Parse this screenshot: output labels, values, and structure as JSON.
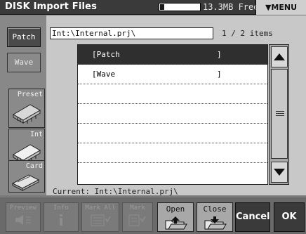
{
  "header": {
    "title": "DISK Import Files",
    "storage_free": "13.3MB Free",
    "storage_used_fraction": 0.1,
    "menu_label": "▼MENU"
  },
  "sidebar": {
    "type_buttons": [
      {
        "label": "Patch",
        "selected": true
      },
      {
        "label": "Wave",
        "selected": false
      }
    ],
    "devices": [
      {
        "label": "Preset",
        "icon": "chip-icon"
      },
      {
        "label": "Int",
        "icon": "chip-icon"
      },
      {
        "label": "Card",
        "icon": "card-icon"
      }
    ]
  },
  "browser": {
    "path": "Int:\\Internal.prj\\",
    "item_count": "1 / 2 items",
    "items": [
      {
        "name": "[Patch",
        "close": "]",
        "selected": true
      },
      {
        "name": "[Wave",
        "close": "]",
        "selected": false
      }
    ],
    "current": "Current: Int:\\Internal.prj\\"
  },
  "function_buttons": {
    "preview": "Preview",
    "info": "Info",
    "mark_all": "Mark All",
    "mark": "Mark",
    "open": "Open",
    "close": "Close",
    "cancel": "Cancel",
    "ok": "OK"
  }
}
